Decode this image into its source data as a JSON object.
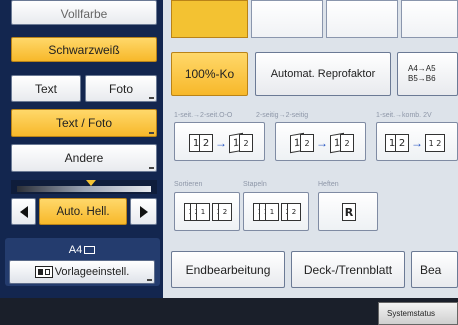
{
  "left": {
    "vollfarbe": "Vollfarbe",
    "schwarzweiss": "Schwarzweiß",
    "text": "Text",
    "foto": "Foto",
    "text_foto": "Text / Foto",
    "andere": "Andere",
    "auto_hell": "Auto. Hell.",
    "paper": "A4",
    "vorlage": "Vorlageeinstell."
  },
  "right": {
    "zoom": "100%-Ko",
    "auto_reduce": "Automat. Reprofaktor",
    "a4_a5": "A4→A5",
    "b5_b6": "B5→B6",
    "dup_label1": "1-seit.→2-seit.O-O",
    "dup_label2": "2-seitig→2-seitig",
    "dup_label3": "1-seit.→komb. 2V",
    "sort_label": "Sortieren",
    "stack_label": "Stapeln",
    "staple_label": "Heften",
    "finish": "Endbearbeitung",
    "cover": "Deck-/Trennblatt",
    "bear": "Bea"
  },
  "status": {
    "system_status": "Systemstatus"
  },
  "colors": {
    "accent_yellow": "#f3c232",
    "nav_blue": "#13264f",
    "arrow_blue": "#1f4fbf"
  }
}
